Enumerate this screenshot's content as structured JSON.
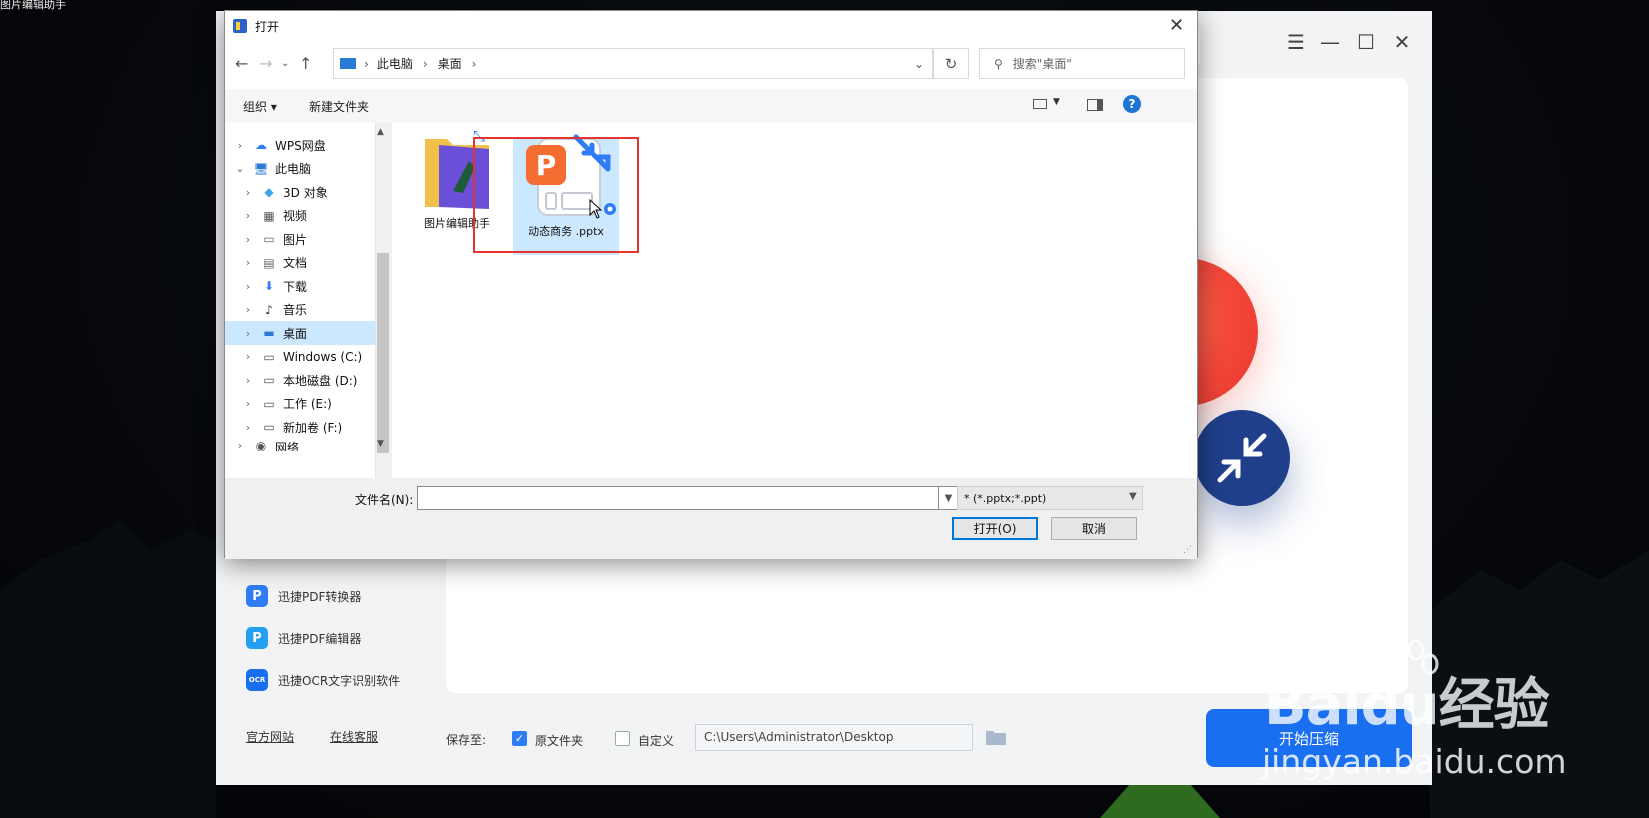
{
  "background": {
    "window_title_fragment": "图片编辑助手"
  },
  "app": {
    "controls": [
      "menu-icon",
      "minimize-icon",
      "maximize-icon",
      "close-icon"
    ],
    "sidebar_links": [
      {
        "label": "迅捷PDF转换器",
        "icon": "P"
      },
      {
        "label": "迅捷PDF编辑器",
        "icon": "P"
      },
      {
        "label": "迅捷OCR文字识别软件",
        "icon": "OCR"
      }
    ],
    "footer_links": [
      "官方网站",
      "在线客服"
    ],
    "save_to_label": "保存至:",
    "option_original": "原文件夹",
    "option_original_checked": true,
    "option_custom": "自定义",
    "option_custom_checked": false,
    "save_path": "C:\\Users\\Administrator\\Desktop",
    "start_button": "开始压缩",
    "accent": "#1a6ff0"
  },
  "dialog": {
    "title": "打开",
    "breadcrumb": [
      "此电脑",
      "桌面"
    ],
    "search_placeholder": "搜索\"桌面\"",
    "toolbar": {
      "organize": "组织 ▾",
      "new_folder": "新建文件夹"
    },
    "nav_items": [
      {
        "label": "WPS网盘",
        "icon": "cloud",
        "indent": 0,
        "expanded": false
      },
      {
        "label": "此电脑",
        "icon": "computer",
        "indent": 0,
        "expanded": true
      },
      {
        "label": "3D 对象",
        "icon": "3d",
        "indent": 1
      },
      {
        "label": "视频",
        "icon": "video",
        "indent": 1
      },
      {
        "label": "图片",
        "icon": "picture",
        "indent": 1
      },
      {
        "label": "文档",
        "icon": "document",
        "indent": 1
      },
      {
        "label": "下载",
        "icon": "download",
        "indent": 1
      },
      {
        "label": "音乐",
        "icon": "music",
        "indent": 1
      },
      {
        "label": "桌面",
        "icon": "desktop",
        "indent": 1,
        "selected": true
      },
      {
        "label": "Windows (C:)",
        "icon": "drive",
        "indent": 1
      },
      {
        "label": "本地磁盘 (D:)",
        "icon": "drive",
        "indent": 1
      },
      {
        "label": "工作 (E:)",
        "icon": "drive",
        "indent": 1
      },
      {
        "label": "新加卷 (F:)",
        "icon": "drive",
        "indent": 1
      },
      {
        "label": "网络",
        "icon": "network",
        "indent": 0
      }
    ],
    "files": [
      {
        "name": "图片编辑助手",
        "type": "folder"
      },
      {
        "name": "动态商务 .pptx",
        "type": "pptx",
        "selected": true
      }
    ],
    "filename_label": "文件名(N):",
    "filename_value": "",
    "file_type_filter": "* (*.pptx;*.ppt)",
    "open_button": "打开(O)",
    "cancel_button": "取消"
  },
  "watermark": {
    "brand": "Baidu经验",
    "url": "jingyan.baidu.com"
  }
}
